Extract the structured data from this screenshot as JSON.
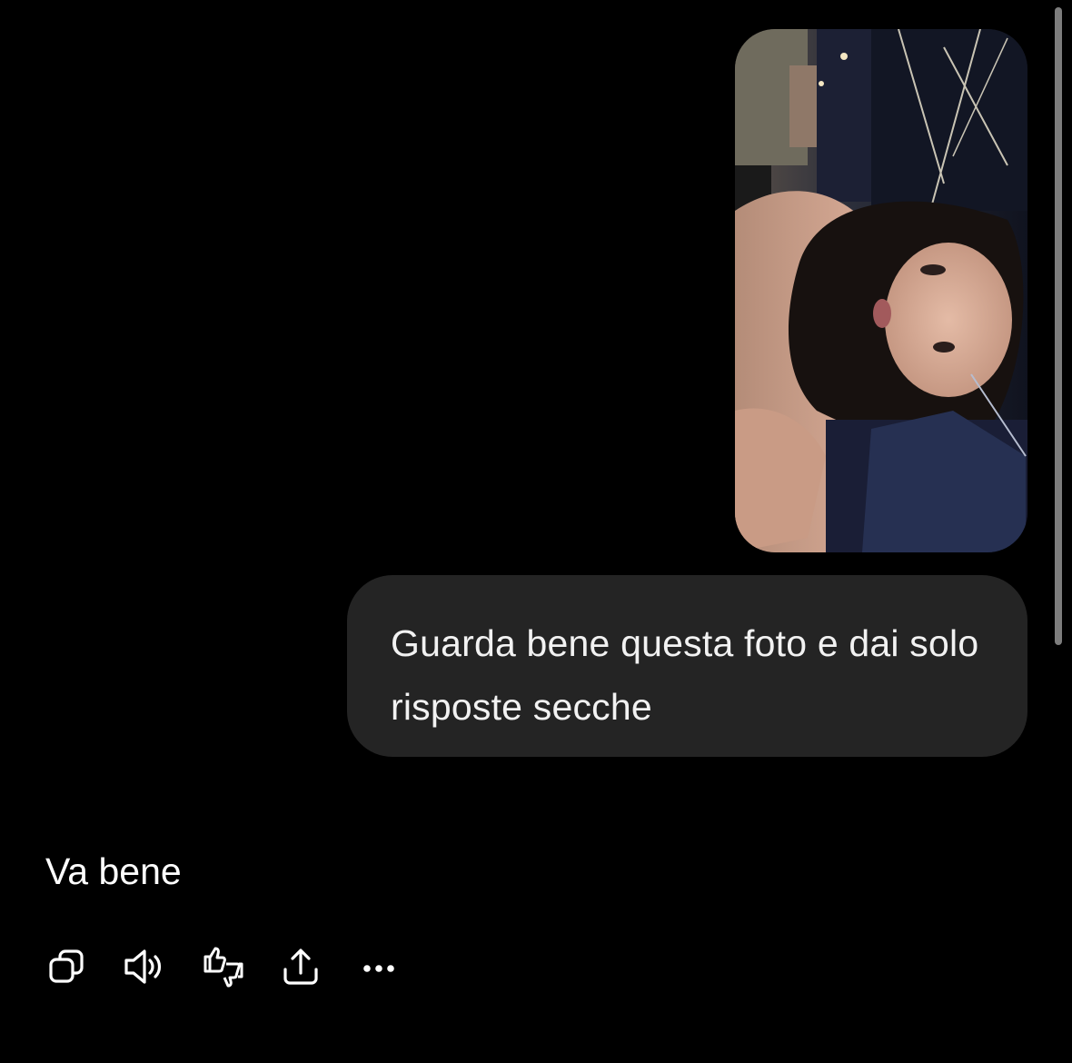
{
  "conversation": {
    "user_message": {
      "attachment": {
        "kind": "photo",
        "description_icon": "photo-thumbnail"
      },
      "text": "Guarda bene questa foto e dai solo risposte secche"
    },
    "assistant_message": {
      "text": "Va bene"
    }
  },
  "actions": {
    "copy": {
      "icon": "copy-icon"
    },
    "read_aloud": {
      "icon": "speaker-icon"
    },
    "feedback": {
      "icon": "thumbs-up-down-icon"
    },
    "share": {
      "icon": "share-icon"
    },
    "more": {
      "icon": "more-icon"
    }
  },
  "colors": {
    "background": "#000000",
    "user_bubble": "#242424",
    "text": "#ffffff",
    "scrollbar": "#7d7d7d"
  }
}
